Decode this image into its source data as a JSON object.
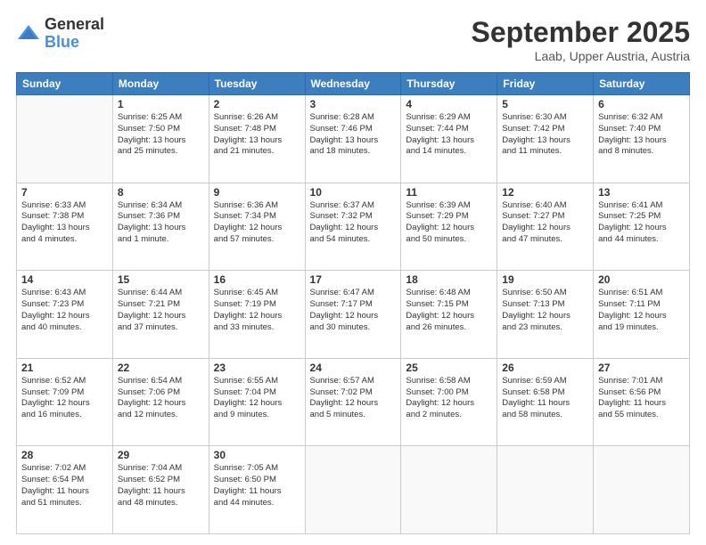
{
  "logo": {
    "general": "General",
    "blue": "Blue"
  },
  "header": {
    "month": "September 2025",
    "location": "Laab, Upper Austria, Austria"
  },
  "weekdays": [
    "Sunday",
    "Monday",
    "Tuesday",
    "Wednesday",
    "Thursday",
    "Friday",
    "Saturday"
  ],
  "weeks": [
    [
      {
        "day": "",
        "info": ""
      },
      {
        "day": "1",
        "info": "Sunrise: 6:25 AM\nSunset: 7:50 PM\nDaylight: 13 hours\nand 25 minutes."
      },
      {
        "day": "2",
        "info": "Sunrise: 6:26 AM\nSunset: 7:48 PM\nDaylight: 13 hours\nand 21 minutes."
      },
      {
        "day": "3",
        "info": "Sunrise: 6:28 AM\nSunset: 7:46 PM\nDaylight: 13 hours\nand 18 minutes."
      },
      {
        "day": "4",
        "info": "Sunrise: 6:29 AM\nSunset: 7:44 PM\nDaylight: 13 hours\nand 14 minutes."
      },
      {
        "day": "5",
        "info": "Sunrise: 6:30 AM\nSunset: 7:42 PM\nDaylight: 13 hours\nand 11 minutes."
      },
      {
        "day": "6",
        "info": "Sunrise: 6:32 AM\nSunset: 7:40 PM\nDaylight: 13 hours\nand 8 minutes."
      }
    ],
    [
      {
        "day": "7",
        "info": "Sunrise: 6:33 AM\nSunset: 7:38 PM\nDaylight: 13 hours\nand 4 minutes."
      },
      {
        "day": "8",
        "info": "Sunrise: 6:34 AM\nSunset: 7:36 PM\nDaylight: 13 hours\nand 1 minute."
      },
      {
        "day": "9",
        "info": "Sunrise: 6:36 AM\nSunset: 7:34 PM\nDaylight: 12 hours\nand 57 minutes."
      },
      {
        "day": "10",
        "info": "Sunrise: 6:37 AM\nSunset: 7:32 PM\nDaylight: 12 hours\nand 54 minutes."
      },
      {
        "day": "11",
        "info": "Sunrise: 6:39 AM\nSunset: 7:29 PM\nDaylight: 12 hours\nand 50 minutes."
      },
      {
        "day": "12",
        "info": "Sunrise: 6:40 AM\nSunset: 7:27 PM\nDaylight: 12 hours\nand 47 minutes."
      },
      {
        "day": "13",
        "info": "Sunrise: 6:41 AM\nSunset: 7:25 PM\nDaylight: 12 hours\nand 44 minutes."
      }
    ],
    [
      {
        "day": "14",
        "info": "Sunrise: 6:43 AM\nSunset: 7:23 PM\nDaylight: 12 hours\nand 40 minutes."
      },
      {
        "day": "15",
        "info": "Sunrise: 6:44 AM\nSunset: 7:21 PM\nDaylight: 12 hours\nand 37 minutes."
      },
      {
        "day": "16",
        "info": "Sunrise: 6:45 AM\nSunset: 7:19 PM\nDaylight: 12 hours\nand 33 minutes."
      },
      {
        "day": "17",
        "info": "Sunrise: 6:47 AM\nSunset: 7:17 PM\nDaylight: 12 hours\nand 30 minutes."
      },
      {
        "day": "18",
        "info": "Sunrise: 6:48 AM\nSunset: 7:15 PM\nDaylight: 12 hours\nand 26 minutes."
      },
      {
        "day": "19",
        "info": "Sunrise: 6:50 AM\nSunset: 7:13 PM\nDaylight: 12 hours\nand 23 minutes."
      },
      {
        "day": "20",
        "info": "Sunrise: 6:51 AM\nSunset: 7:11 PM\nDaylight: 12 hours\nand 19 minutes."
      }
    ],
    [
      {
        "day": "21",
        "info": "Sunrise: 6:52 AM\nSunset: 7:09 PM\nDaylight: 12 hours\nand 16 minutes."
      },
      {
        "day": "22",
        "info": "Sunrise: 6:54 AM\nSunset: 7:06 PM\nDaylight: 12 hours\nand 12 minutes."
      },
      {
        "day": "23",
        "info": "Sunrise: 6:55 AM\nSunset: 7:04 PM\nDaylight: 12 hours\nand 9 minutes."
      },
      {
        "day": "24",
        "info": "Sunrise: 6:57 AM\nSunset: 7:02 PM\nDaylight: 12 hours\nand 5 minutes."
      },
      {
        "day": "25",
        "info": "Sunrise: 6:58 AM\nSunset: 7:00 PM\nDaylight: 12 hours\nand 2 minutes."
      },
      {
        "day": "26",
        "info": "Sunrise: 6:59 AM\nSunset: 6:58 PM\nDaylight: 11 hours\nand 58 minutes."
      },
      {
        "day": "27",
        "info": "Sunrise: 7:01 AM\nSunset: 6:56 PM\nDaylight: 11 hours\nand 55 minutes."
      }
    ],
    [
      {
        "day": "28",
        "info": "Sunrise: 7:02 AM\nSunset: 6:54 PM\nDaylight: 11 hours\nand 51 minutes."
      },
      {
        "day": "29",
        "info": "Sunrise: 7:04 AM\nSunset: 6:52 PM\nDaylight: 11 hours\nand 48 minutes."
      },
      {
        "day": "30",
        "info": "Sunrise: 7:05 AM\nSunset: 6:50 PM\nDaylight: 11 hours\nand 44 minutes."
      },
      {
        "day": "",
        "info": ""
      },
      {
        "day": "",
        "info": ""
      },
      {
        "day": "",
        "info": ""
      },
      {
        "day": "",
        "info": ""
      }
    ]
  ]
}
